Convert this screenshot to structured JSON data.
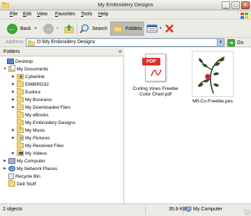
{
  "window": {
    "title": "My Embroidery Designs",
    "buttons": [
      "_",
      "□",
      "×"
    ]
  },
  "menu": [
    "File",
    "Edit",
    "View",
    "Favorites",
    "Tools",
    "Help"
  ],
  "toolbar": {
    "back": "Back",
    "search": "Search",
    "folders": "Folders"
  },
  "address": {
    "label": "Address",
    "value": "D:\\My Embroidery Designs",
    "go": "Go"
  },
  "folders_pane": {
    "title": "Folders",
    "close": "×",
    "tree": [
      {
        "label": "Desktop"
      },
      {
        "label": "My Documents"
      },
      {
        "label": "Cyberlink"
      },
      {
        "label": "EMBIRD32"
      },
      {
        "label": "Eudora"
      },
      {
        "label": "My Business"
      },
      {
        "label": "My Downloaded Files"
      },
      {
        "label": "My eBooks"
      },
      {
        "label": "My Embroidery Designs"
      },
      {
        "label": "My Music"
      },
      {
        "label": "My Pictures"
      },
      {
        "label": "My Received Files"
      },
      {
        "label": "My Videos"
      },
      {
        "label": "My Computer"
      },
      {
        "label": "My Network Places"
      },
      {
        "label": "Recycle Bin"
      },
      {
        "label": "Dell Stuff"
      }
    ]
  },
  "files": [
    {
      "name": "Curling Vines Freebie Color Chart.pdf",
      "badge": "PDF",
      "icon": "pdf-file-icon"
    },
    {
      "name": "Mfi-Cv-Freebie.pes",
      "icon": "embroidery-thumbnail"
    }
  ],
  "status": {
    "objects": "2 objects",
    "size": "35.9 KB",
    "location": "My Computer"
  },
  "colors": {
    "chrome": "#ecebe5",
    "accent_red": "#d9322a",
    "folder": "#f1d57e",
    "back_green": "#3ea43a"
  }
}
